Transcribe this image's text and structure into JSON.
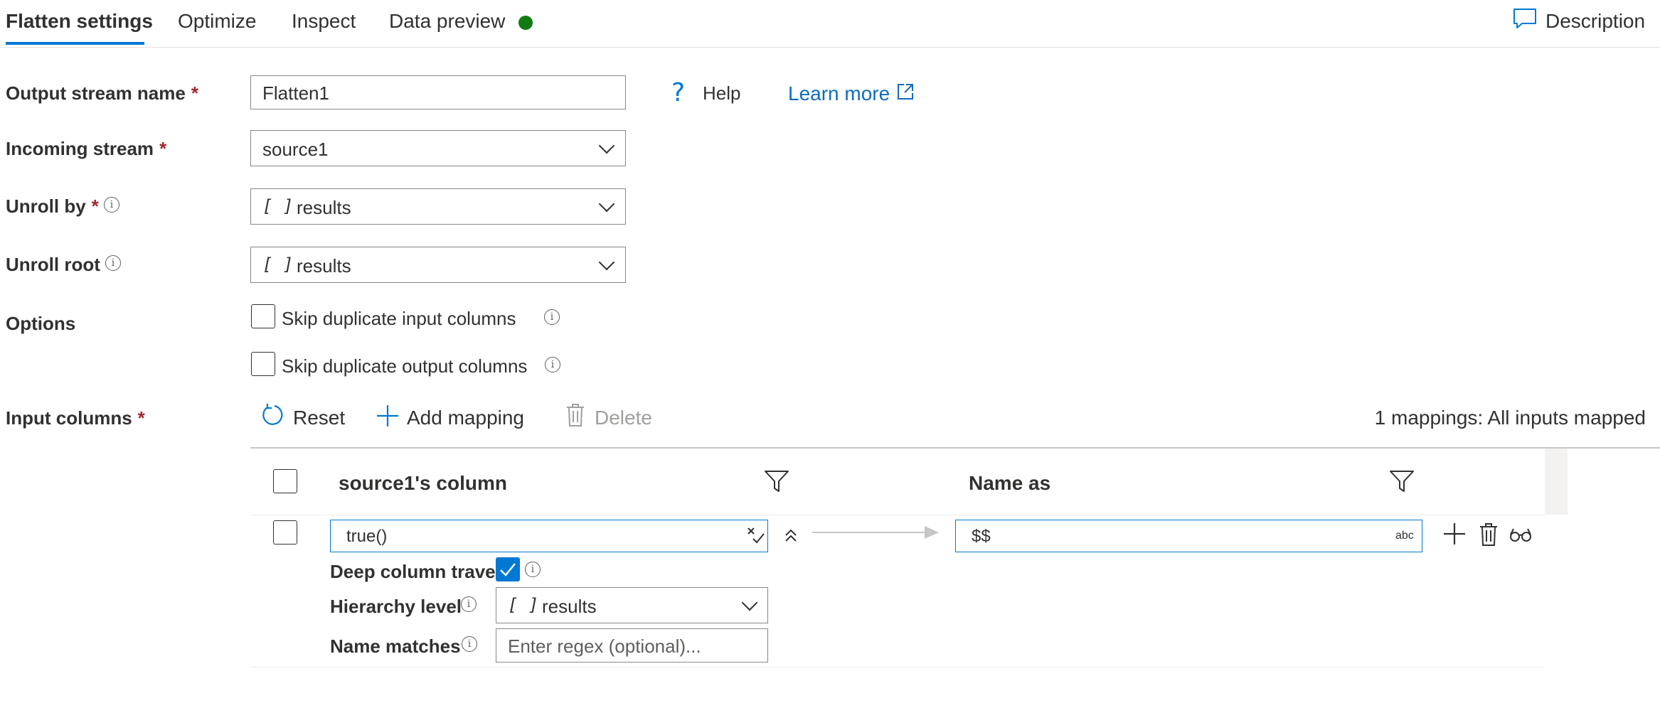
{
  "tabs": [
    {
      "label": "Flatten settings",
      "active": true
    },
    {
      "label": "Optimize"
    },
    {
      "label": "Inspect"
    },
    {
      "label": "Data preview"
    }
  ],
  "data_preview_status_color": "#107c10",
  "description_label": "Description",
  "form": {
    "output_stream_name": {
      "label": "Output stream name",
      "required": "*",
      "value": "Flatten1"
    },
    "incoming_stream": {
      "label": "Incoming stream",
      "required": "*",
      "value": "source1"
    },
    "unroll_by": {
      "label": "Unroll by",
      "required": "*",
      "value": "results",
      "type_glyph": "[ ]"
    },
    "unroll_root": {
      "label": "Unroll root",
      "value": "results",
      "type_glyph": "[ ]"
    },
    "options": {
      "label": "Options",
      "skip_duplicate_input": {
        "label": "Skip duplicate input columns",
        "checked": false
      },
      "skip_duplicate_output": {
        "label": "Skip duplicate output columns",
        "checked": false
      }
    }
  },
  "help_label": "Help",
  "learn_more_label": "Learn more",
  "input_columns": {
    "label": "Input columns",
    "required": "*",
    "toolbar": {
      "reset_label": "Reset",
      "add_mapping_label": "Add mapping",
      "delete_label": "Delete"
    },
    "mapping_status": "1 mappings: All inputs mapped",
    "headers": {
      "source_column": "source1's column",
      "name_as": "Name as"
    },
    "row": {
      "source_expression": "true()",
      "name_as_value": "$$",
      "type_badge": "abc",
      "deep_column_traversal_label": "Deep column traver",
      "deep_column_traversal_checked": true,
      "hierarchy_level_label": "Hierarchy level",
      "hierarchy_level_value": "results",
      "hierarchy_type_glyph": "[ ]",
      "name_matches_label": "Name matches",
      "name_matches_placeholder": "Enter regex (optional)..."
    }
  },
  "colors": {
    "accent": "#0078d4",
    "required": "#a4262c",
    "link": "#0f6cbd",
    "disabled": "#a19f9d"
  }
}
